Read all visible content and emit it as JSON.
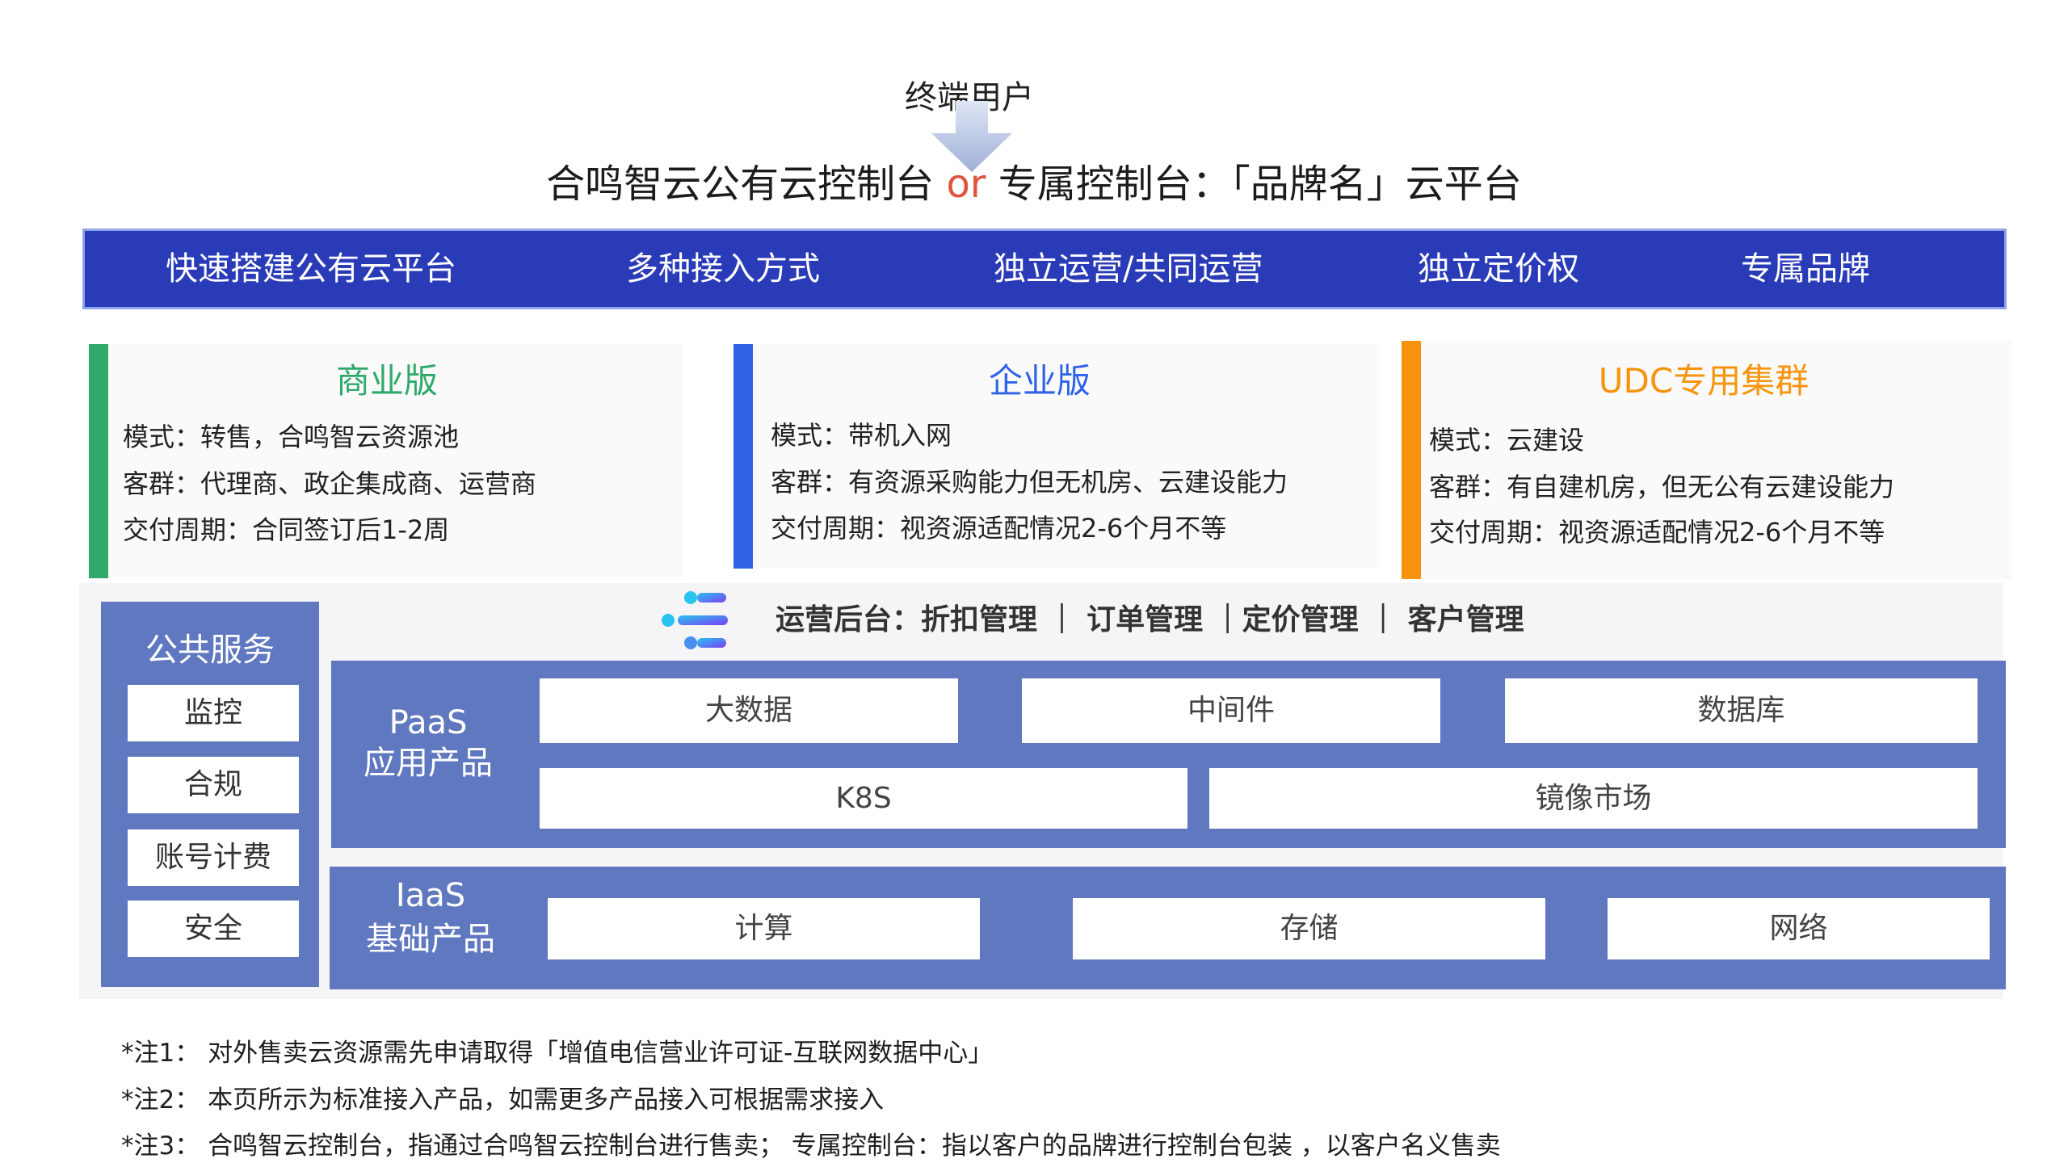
{
  "top": {
    "end_user": "终端用户",
    "title_part1": "合鸣智云公有云控制台 ",
    "title_or": "or",
    "title_part2": " 专属控制台：「品牌名」云平台"
  },
  "features": [
    "快速搭建公有云平台",
    "多种接入方式",
    "独立运营/共同运营",
    "独立定价权",
    "专属品牌"
  ],
  "editions": [
    {
      "title": "商业版",
      "color": "#2faa6b",
      "lines": [
        "模式：转售，合鸣智云资源池",
        "客群：代理商、政企集成商、运营商",
        "交付周期：合同签订后1-2周"
      ]
    },
    {
      "title": "企业版",
      "color": "#2f63e8",
      "lines": [
        "模式：带机入网",
        "客群：有资源采购能力但无机房、云建设能力",
        "交付周期：视资源适配情况2-6个月不等"
      ]
    },
    {
      "title": "UDC专用集群",
      "color": "#f7940d",
      "lines": [
        "模式：云建设",
        "客群：有自建机房，但无公有云建设能力",
        "交付周期：视资源适配情况2-6个月不等"
      ]
    }
  ],
  "public_services": {
    "title": "公共服务",
    "items": [
      "监控",
      "合规",
      "账号计费",
      "安全"
    ]
  },
  "ops": {
    "text": "运营后台：折扣管理 ｜ 订单管理 ｜定价管理 ｜ 客户管理"
  },
  "paas": {
    "label_line1": "PaaS",
    "label_line2": "应用产品",
    "products": [
      "大数据",
      "中间件",
      "数据库",
      "K8S",
      "镜像市场"
    ]
  },
  "iaas": {
    "label_line1": "IaaS",
    "label_line2": "基础产品",
    "products": [
      "计算",
      "存储",
      "网络"
    ]
  },
  "notes": [
    "*注1： 对外售卖云资源需先申请取得「增值电信营业许可证-互联网数据中心」",
    "*注2： 本页所示为标准接入产品，如需更多产品接入可根据需求接入",
    "*注3： 合鸣智云控制台，指通过合鸣智云控制台进行售卖； 专属控制台：指以客户的品牌进行控制台包装 ，以客户名义售卖"
  ]
}
